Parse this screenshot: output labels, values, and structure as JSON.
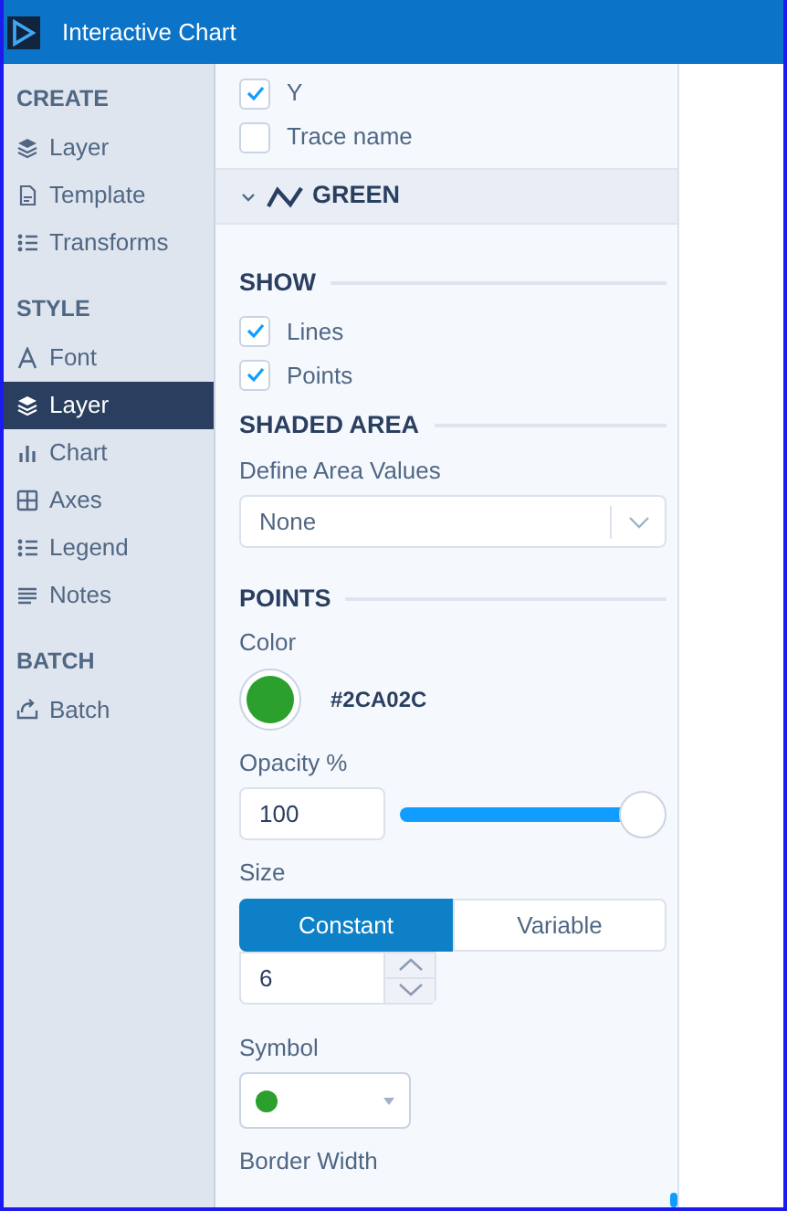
{
  "window": {
    "title": "Interactive Chart"
  },
  "sidebar": {
    "sections": [
      {
        "title": "CREATE",
        "items": [
          {
            "label": "Layer",
            "selected": false
          },
          {
            "label": "Template",
            "selected": false
          },
          {
            "label": "Transforms",
            "selected": false
          }
        ]
      },
      {
        "title": "STYLE",
        "items": [
          {
            "label": "Font",
            "selected": false
          },
          {
            "label": "Layer",
            "selected": true
          },
          {
            "label": "Chart",
            "selected": false
          },
          {
            "label": "Axes",
            "selected": false
          },
          {
            "label": "Legend",
            "selected": false
          },
          {
            "label": "Notes",
            "selected": false
          }
        ]
      },
      {
        "title": "BATCH",
        "items": [
          {
            "label": "Batch",
            "selected": false
          }
        ]
      }
    ]
  },
  "panel": {
    "top_checkboxes": [
      {
        "label": "Y",
        "checked": true
      },
      {
        "label": "Trace name",
        "checked": false
      }
    ],
    "trace": {
      "name": "GREEN",
      "expanded": true
    },
    "sections": [
      {
        "title": "SHOW",
        "fields": [
          {
            "kind": "checkbox",
            "label": "Lines",
            "checked": true
          },
          {
            "kind": "checkbox",
            "label": "Points",
            "checked": true
          }
        ]
      },
      {
        "title": "SHADED AREA",
        "fields": [
          {
            "kind": "select",
            "label": "Define Area Values",
            "value": "None"
          }
        ]
      },
      {
        "title": "POINTS",
        "fields": [
          {
            "kind": "color",
            "label": "Color",
            "value": "#2CA02C",
            "color": "#2ca02c"
          },
          {
            "kind": "slider",
            "label": "Opacity %",
            "value": "100",
            "level": 1.0
          },
          {
            "kind": "toggle",
            "label": "Size",
            "options": [
              {
                "label": "Constant",
                "selected": true
              },
              {
                "label": "Variable",
                "selected": false
              }
            ],
            "value": "6"
          },
          {
            "kind": "symbol",
            "label": "Symbol",
            "color": "#2ca02c"
          },
          {
            "kind": "label",
            "label": "Border Width"
          }
        ]
      }
    ]
  }
}
